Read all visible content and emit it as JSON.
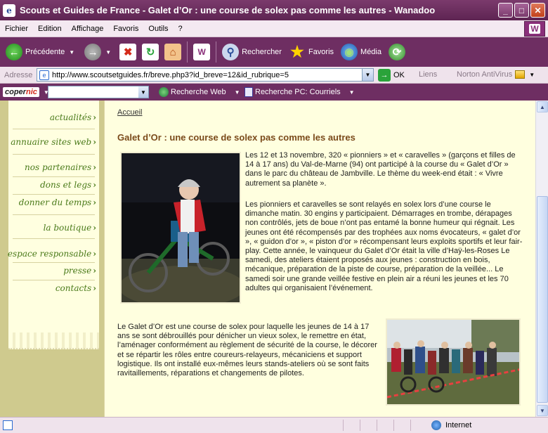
{
  "window": {
    "title": "Scouts et Guides de France - Galet d’Or : une course de solex pas comme les autres - Wanadoo"
  },
  "menu": [
    "Fichier",
    "Edition",
    "Affichage",
    "Favoris",
    "Outils",
    "?"
  ],
  "toolbar": {
    "back": "Précédente",
    "search": "Rechercher",
    "favorites": "Favoris",
    "media": "Média"
  },
  "address": {
    "label": "Adresse",
    "url": "http://www.scoutsetguides.fr/breve.php3?id_breve=12&id_rubrique=5",
    "go": "OK",
    "links": "Liens",
    "norton": "Norton AntiVirus"
  },
  "copernic": {
    "logo_a": "coper",
    "logo_b": "nic",
    "web_search": "Recherche Web",
    "pc_search": "Recherche PC: Courriels"
  },
  "nav": {
    "items": [
      "actualités",
      "annuaire sites web",
      "nos partenaires",
      "dons et legs",
      "donner du temps",
      "la boutique",
      "espace responsable",
      "presse",
      "contacts"
    ]
  },
  "article": {
    "breadcrumb": "Accueil",
    "title": "Galet d’Or : une course de solex pas comme les autres",
    "p1": "Les 12 et 13 novembre, 320 « pionniers » et « caravelles » (garçons et filles de 14 à 17 ans) du Val-de-Marne (94) ont participé à la course du « Galet d’Or » dans le parc du château de Jambville. Le thème du week-end était : « Vivre autrement sa planète ».",
    "p2": "Les pionniers et caravelles se sont relayés en solex lors d’une course le dimanche matin. 30 engins y participaient. Démarrages en trombe, dérapages non contrôlés, jets de boue n’ont pas entamé la bonne humeur qui régnait. Les jeunes ont été récompensés par des trophées aux noms évocateurs, « galet d’or », « guidon d’or », « piston d’or » récompensant leurs exploits sportifs et leur fair-play. Cette année, le vainqueur du Galet d’Or était la ville d’Haÿ-les-Roses Le samedi, des ateliers étaient proposés aux jeunes : construction en bois, mécanique, préparation de la piste de course, préparation de la veillée... Le samedi soir une grande veillée festive en plein air a réuni les jeunes et les 70 adultes qui organisaient l’événement.",
    "p3": "Le Galet d’Or est une course de solex pour laquelle les jeunes de 14 à 17 ans se sont débrouillés pour dénicher un vieux solex, le remettre en état, l’aménager conformément au règlement de sécurité de la course, le décorer et se répartir les rôles entre coureurs-relayeurs, mécaniciens et support logistique. Ils ont installé eux-mêmes leurs stands-ateliers où se sont faits ravitaillements, réparations et changements de pilotes."
  },
  "status": {
    "zone": "Internet"
  },
  "icons": [
    "ie-icon",
    "back-icon",
    "forward-icon",
    "stop-icon",
    "refresh-icon",
    "home-icon",
    "wanadoo-icon",
    "search-icon",
    "star-icon",
    "media-icon",
    "history-icon"
  ]
}
